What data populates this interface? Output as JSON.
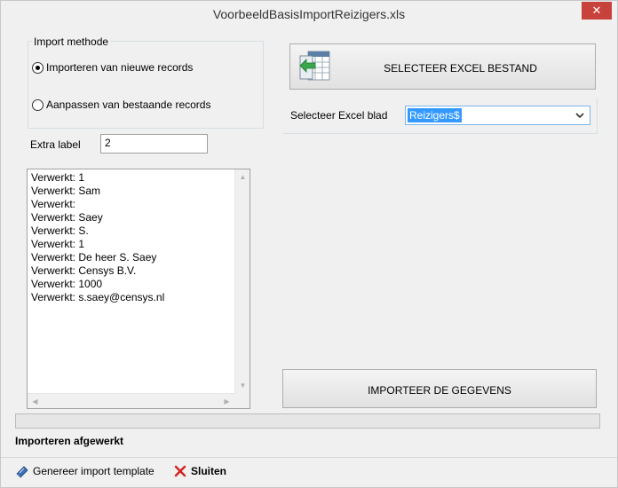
{
  "window": {
    "title": "VoorbeeldBasisImportReizigers.xls",
    "close_glyph": "✕"
  },
  "import_method": {
    "legend": "Import methode",
    "options": [
      {
        "label": "Importeren van nieuwe records",
        "selected": true
      },
      {
        "label": "Aanpassen van bestaande records",
        "selected": false
      }
    ]
  },
  "extra_label": {
    "label": "Extra label",
    "value": "2"
  },
  "log": {
    "lines": [
      "Verwerkt: 1",
      "Verwerkt: Sam",
      "Verwerkt:",
      "Verwerkt: Saey",
      "Verwerkt: S.",
      "Verwerkt: 1",
      "Verwerkt: De heer S. Saey",
      "Verwerkt: Censys B.V.",
      "Verwerkt: 1000",
      "Verwerkt: s.saey@censys.nl"
    ]
  },
  "select_excel_button": {
    "label": "SELECTEER EXCEL BESTAND",
    "icon": "excel-file-icon"
  },
  "sheet": {
    "label": "Selecteer Excel blad",
    "value": "Reizigers$"
  },
  "import_button": {
    "label": "IMPORTEER DE GEGEVENS"
  },
  "progress": {
    "value": 0
  },
  "status": {
    "text": "Importeren afgewerkt"
  },
  "bottom_bar": {
    "template_label": "Genereer import template",
    "close_label": "Sluiten"
  },
  "colors": {
    "close_red": "#c7423a",
    "selection_blue": "#3399ff",
    "progress_green": "#06b025"
  }
}
